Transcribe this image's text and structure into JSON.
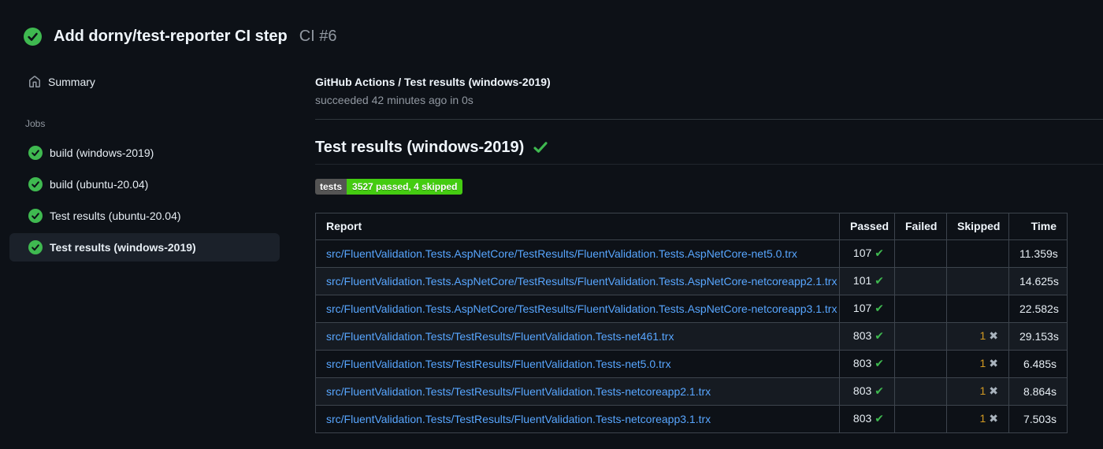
{
  "run_header": {
    "title": "Add dorny/test-reporter CI step",
    "run_number": "CI #6",
    "status": "success"
  },
  "sidebar": {
    "summary_label": "Summary",
    "jobs_heading": "Jobs",
    "jobs": [
      {
        "label": "build (windows-2019)",
        "status": "success",
        "selected": false
      },
      {
        "label": "build (ubuntu-20.04)",
        "status": "success",
        "selected": false
      },
      {
        "label": "Test results (ubuntu-20.04)",
        "status": "success",
        "selected": false
      },
      {
        "label": "Test results (windows-2019)",
        "status": "success",
        "selected": true
      }
    ]
  },
  "main": {
    "job_title": "GitHub Actions / Test results (windows-2019)",
    "job_subtitle": "succeeded 42 minutes ago in 0s",
    "section_heading": "Test results (windows-2019)",
    "section_status": "success",
    "badge": {
      "label": "tests",
      "value": "3527 passed, 4 skipped",
      "label_bg": "#545454",
      "value_bg": "#44cc11"
    },
    "table": {
      "columns": [
        "Report",
        "Passed",
        "Failed",
        "Skipped",
        "Time"
      ],
      "rows": [
        {
          "report": "src/FluentValidation.Tests.AspNetCore/TestResults/FluentValidation.Tests.AspNetCore-net5.0.trx",
          "passed": "107",
          "failed": "",
          "skipped": "",
          "time": "11.359s"
        },
        {
          "report": "src/FluentValidation.Tests.AspNetCore/TestResults/FluentValidation.Tests.AspNetCore-netcoreapp2.1.trx",
          "passed": "101",
          "failed": "",
          "skipped": "",
          "time": "14.625s"
        },
        {
          "report": "src/FluentValidation.Tests.AspNetCore/TestResults/FluentValidation.Tests.AspNetCore-netcoreapp3.1.trx",
          "passed": "107",
          "failed": "",
          "skipped": "",
          "time": "22.582s"
        },
        {
          "report": "src/FluentValidation.Tests/TestResults/FluentValidation.Tests-net461.trx",
          "passed": "803",
          "failed": "",
          "skipped": "1",
          "time": "29.153s"
        },
        {
          "report": "src/FluentValidation.Tests/TestResults/FluentValidation.Tests-net5.0.trx",
          "passed": "803",
          "failed": "",
          "skipped": "1",
          "time": "6.485s"
        },
        {
          "report": "src/FluentValidation.Tests/TestResults/FluentValidation.Tests-netcoreapp2.1.trx",
          "passed": "803",
          "failed": "",
          "skipped": "1",
          "time": "8.864s"
        },
        {
          "report": "src/FluentValidation.Tests/TestResults/FluentValidation.Tests-netcoreapp3.1.trx",
          "passed": "803",
          "failed": "",
          "skipped": "1",
          "time": "7.503s"
        }
      ]
    },
    "glyphs": {
      "passed_icon": "✔",
      "skipped_icon": "✖"
    }
  },
  "colors": {
    "background": "#0d1117",
    "success_green": "#3fb950",
    "link_blue": "#58a6ff",
    "skipped_yellow": "#d29922",
    "table_border": "#3d444d",
    "row_alt": "#161b22"
  }
}
